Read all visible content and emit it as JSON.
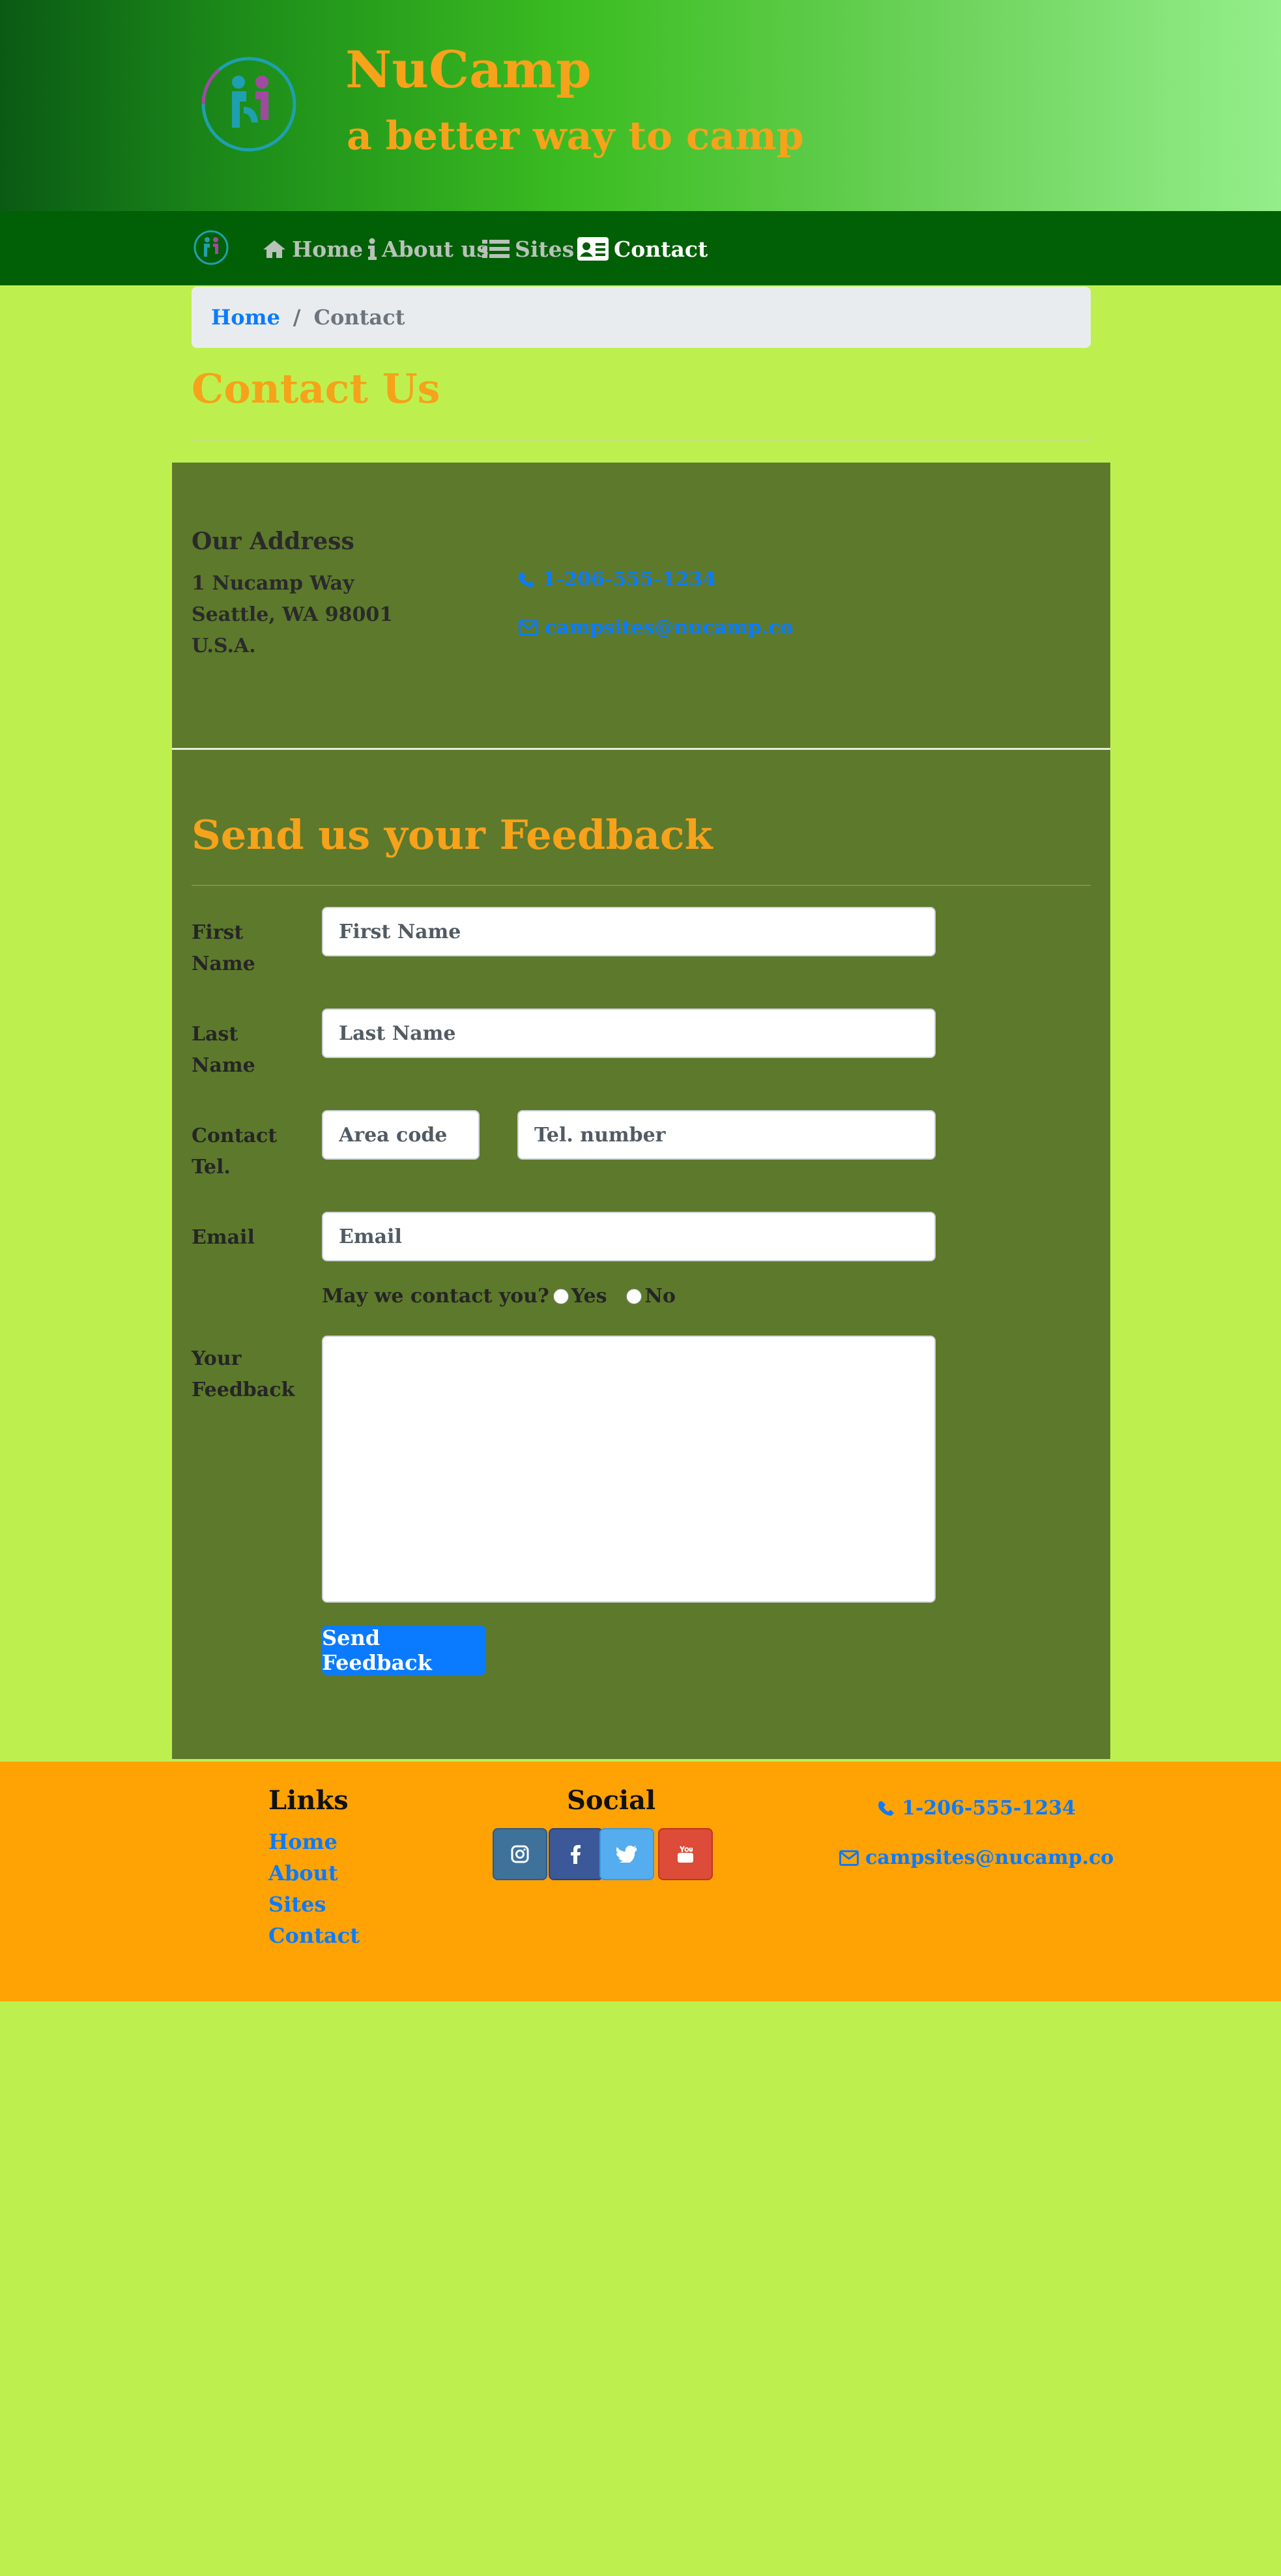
{
  "header": {
    "title": "NuCamp",
    "tagline": "a better way to camp"
  },
  "nav": {
    "items": [
      {
        "label": "Home",
        "icon": "home-icon"
      },
      {
        "label": "About us",
        "icon": "info-icon"
      },
      {
        "label": "Sites",
        "icon": "list-icon"
      },
      {
        "label": "Contact",
        "icon": "address-card-icon",
        "active": true
      }
    ]
  },
  "breadcrumb": {
    "home": "Home",
    "separator": "/",
    "current": "Contact"
  },
  "page": {
    "heading": "Contact Us"
  },
  "address": {
    "heading": "Our Address",
    "lines": [
      "1 Nucamp Way",
      "Seattle, WA 98001",
      "U.S.A."
    ],
    "phone": "1-206-555-1234",
    "email": "campsites@nucamp.co"
  },
  "feedback": {
    "heading": "Send us your Feedback",
    "labels": {
      "first_name": "First Name",
      "last_name": "Last Name",
      "contact_tel": "Contact Tel.",
      "email": "Email",
      "feedback": "Your Feedback"
    },
    "placeholders": {
      "first_name": "First Name",
      "last_name": "Last Name",
      "area_code": "Area code",
      "tel_number": "Tel. number",
      "email": "Email"
    },
    "contact_question": "May we contact you?",
    "yes": "Yes",
    "no": "No",
    "submit": "Send Feedback"
  },
  "footer": {
    "links_heading": "Links",
    "links": [
      "Home",
      "About",
      "Sites",
      "Contact"
    ],
    "social_heading": "Social",
    "social": [
      {
        "icon": "instagram-icon",
        "color": "#3f729b"
      },
      {
        "icon": "facebook-icon",
        "color": "#3b5998"
      },
      {
        "icon": "twitter-icon",
        "color": "#55acee"
      },
      {
        "icon": "youtube-icon",
        "color": "#dd4b39"
      }
    ],
    "phone": "1-206-555-1234",
    "email": "campsites@nucamp.co"
  },
  "colors": {
    "background": "#bdf04f",
    "accent_orange": "#f6a21a",
    "nav": "#015f06",
    "panel": "#5d792c",
    "footer": "#ffa203",
    "link": "#0a7bff"
  }
}
